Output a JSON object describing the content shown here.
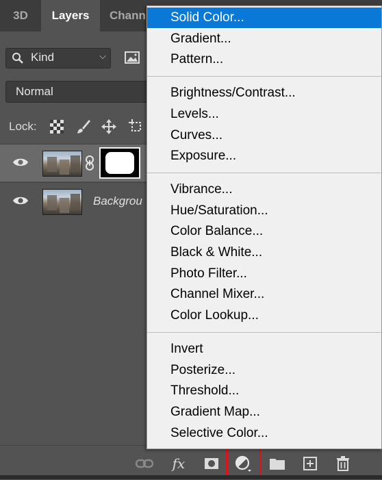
{
  "tabs": [
    {
      "label": "3D",
      "active": false
    },
    {
      "label": "Layers",
      "active": true
    },
    {
      "label": "Chann",
      "active": false
    }
  ],
  "filter": {
    "label": "Kind"
  },
  "blend_mode": {
    "value": "Normal"
  },
  "lock": {
    "label": "Lock:"
  },
  "layers": [
    {
      "name": "",
      "visible": true,
      "selected": true,
      "has_mask": true
    },
    {
      "name": "Backgrou",
      "visible": true,
      "selected": false,
      "has_mask": false
    }
  ],
  "menu": {
    "highlighted_item": "Solid Color...",
    "groups": [
      [
        "Solid Color...",
        "Gradient...",
        "Pattern..."
      ],
      [
        "Brightness/Contrast...",
        "Levels...",
        "Curves...",
        "Exposure..."
      ],
      [
        "Vibrance...",
        "Hue/Saturation...",
        "Color Balance...",
        "Black & White...",
        "Photo Filter...",
        "Channel Mixer...",
        "Color Lookup..."
      ],
      [
        "Invert",
        "Posterize...",
        "Threshold...",
        "Gradient Map...",
        "Selective Color..."
      ]
    ]
  },
  "bottom_toolbar": {
    "fx_label": "fx",
    "icons": [
      "link-layers-icon",
      "fx-icon",
      "add-mask-icon",
      "adjustment-layer-icon",
      "new-group-icon",
      "new-layer-icon",
      "delete-icon"
    ]
  },
  "colors": {
    "menu_highlight": "#0a78d7",
    "callout_border": "#e3101a"
  }
}
